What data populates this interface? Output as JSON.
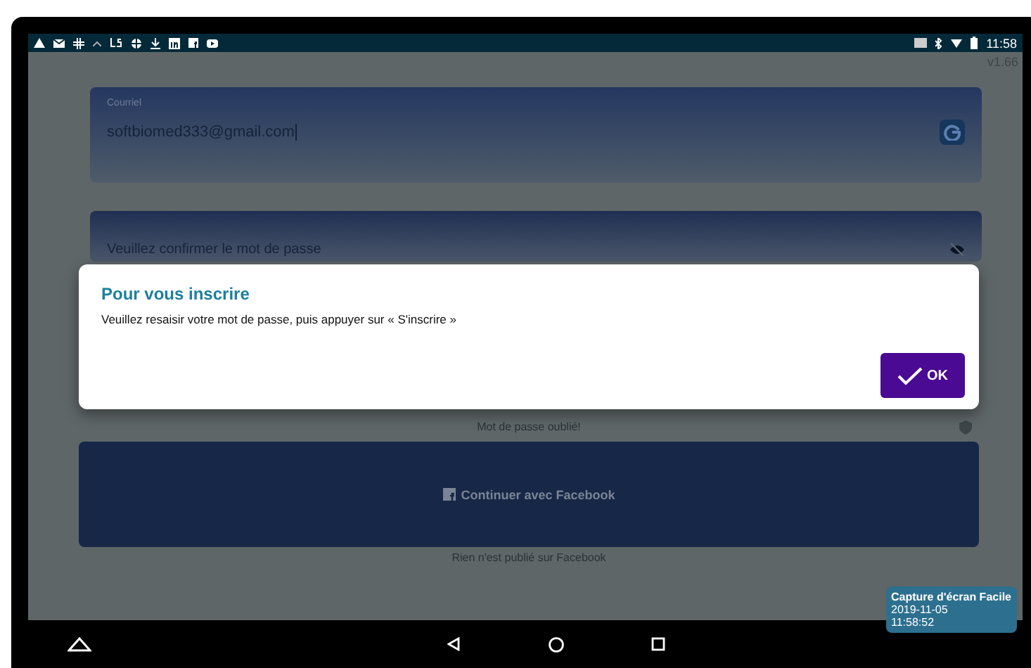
{
  "status_bar": {
    "time": "11:58"
  },
  "version": "v1.66",
  "email_field": {
    "label": "Courriel",
    "value": "softbiomed333@gmail.com"
  },
  "password_field": {
    "placeholder": "Veuillez confirmer le mot de passe"
  },
  "dialog": {
    "title": "Pour vous inscrire",
    "message": "Veuillez resaisir votre mot de passe, puis appuyer sur « S'inscrire »",
    "button": "OK"
  },
  "forgot_link": "Mot de passe oublié!",
  "facebook_button": "Continuer avec Facebook",
  "facebook_note": "Rien n'est publié sur Facebook",
  "capture_badge": {
    "title": "Capture d'écran Facile",
    "date": "2019-11-05",
    "time": "11:58:52"
  }
}
